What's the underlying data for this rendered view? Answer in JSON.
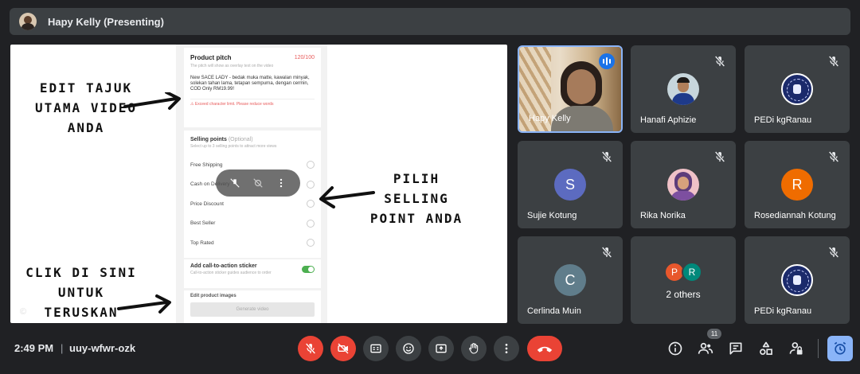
{
  "header": {
    "presenter_title": "Hapy Kelly (Presenting)"
  },
  "presentation": {
    "product_pitch": {
      "title": "Product pitch",
      "counter": "120/100",
      "subtitle": "The pitch will show as overlay text on the video",
      "body": "New SACE LADY - bedak muka matte, kawalan minyak, solekan tahan lama, tetapan sempurna, dengan cermin, COD Only RM19.99!",
      "warning": "⚠ Exceed character limit. Please reduce words"
    },
    "selling_points": {
      "title": "Selling points",
      "optional": "(Optional)",
      "subtitle": "Select up to 3 selling points to attract more views",
      "items": [
        "Free Shipping",
        "Cash on Delivery",
        "Price Discount",
        "Best Seller",
        "Top Rated"
      ]
    },
    "cta": {
      "title": "Add call-to-action sticker",
      "subtitle": "Call-to-action sticker guides audience to order",
      "toggle_on": true
    },
    "edit_product_images": {
      "title": "Edit product images"
    },
    "generate_button": "Generate video",
    "annotations": {
      "edit_title": "EDIT TAJUK UTAMA VIDEO ANDA",
      "selling_point": "PILIH SELLING POINT ANDA",
      "click_here": "CLIK DI SINI UNTUK TERUSKAN"
    },
    "watermark": "©"
  },
  "participants": [
    {
      "name": "Hapy Kelly",
      "speaking": true
    },
    {
      "name": "Hanafi Aphizie",
      "muted": true
    },
    {
      "name": "PEDi kgRanau",
      "muted": true
    },
    {
      "name": "Sujie Kotung",
      "initial": "S",
      "color": "#5c6bc0",
      "muted": true
    },
    {
      "name": "Rika Norika",
      "muted": true
    },
    {
      "name": "Rosediannah Kotung",
      "initial": "R",
      "color": "#ef6c00",
      "muted": true
    },
    {
      "name": "Cerlinda Muin",
      "initial": "C",
      "color": "#607d8b",
      "muted": true
    },
    {
      "name": "2 others",
      "avatars": [
        {
          "initial": "P",
          "color": "#e8572c"
        },
        {
          "initial": "R",
          "color": "#00897b"
        }
      ]
    },
    {
      "name": "PEDi kgRanau",
      "muted": true
    }
  ],
  "bottom_bar": {
    "time": "2:49 PM",
    "separator": "|",
    "meeting_code": "uuy-wfwr-ozk",
    "people_count": "11",
    "controls": [
      "mic-off",
      "camera-off",
      "captions",
      "emoji",
      "present",
      "raise-hand",
      "more",
      "end-call"
    ],
    "right_icons": [
      "info",
      "people",
      "chat",
      "activities",
      "host-controls",
      "timer"
    ]
  },
  "colors": {
    "bg": "#202124",
    "tile": "#3c4043",
    "red": "#ea4335",
    "accent": "#8ab4f8",
    "speaking": "#1a73e8"
  }
}
